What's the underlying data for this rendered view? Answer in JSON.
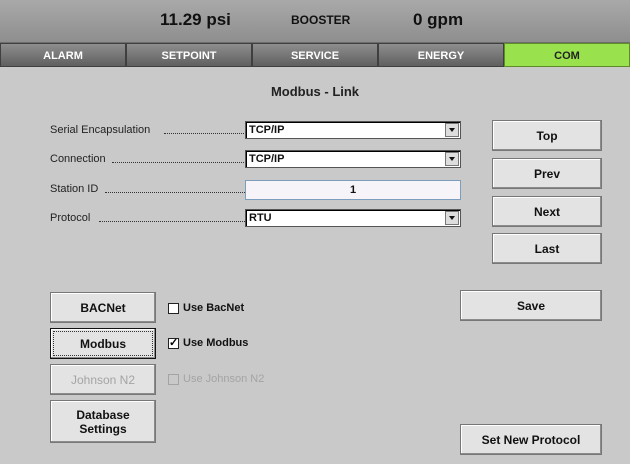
{
  "status": {
    "pressure": "11.29 psi",
    "mode": "BOOSTER",
    "flow": "0 gpm"
  },
  "tabs": [
    {
      "label": "ALARM"
    },
    {
      "label": "SETPOINT"
    },
    {
      "label": "SERVICE"
    },
    {
      "label": "ENERGY"
    },
    {
      "label": "COM",
      "active": true
    }
  ],
  "page_title": "Modbus - Link",
  "form": {
    "serial_encapsulation": {
      "label": "Serial Encapsulation",
      "value": "TCP/IP"
    },
    "connection": {
      "label": "Connection",
      "value": "TCP/IP"
    },
    "station_id": {
      "label": "Station ID",
      "value": "1"
    },
    "protocol": {
      "label": "Protocol",
      "value": "RTU"
    }
  },
  "nav_buttons": {
    "top": "Top",
    "prev": "Prev",
    "next": "Next",
    "last": "Last"
  },
  "protocol_buttons": {
    "bacnet": "BACNet",
    "modbus": "Modbus",
    "johnson": "Johnson N2",
    "database": "Database Settings"
  },
  "checkboxes": {
    "use_bacnet": {
      "label": "Use BacNet",
      "checked": false
    },
    "use_modbus": {
      "label": "Use Modbus",
      "checked": true
    },
    "use_johnson": {
      "label": "Use Johnson N2",
      "checked": false,
      "disabled": true
    }
  },
  "actions": {
    "save": "Save",
    "set_new_protocol": "Set New Protocol"
  },
  "colors": {
    "active_tab": "#99e24d",
    "background": "#c9c9c9"
  }
}
